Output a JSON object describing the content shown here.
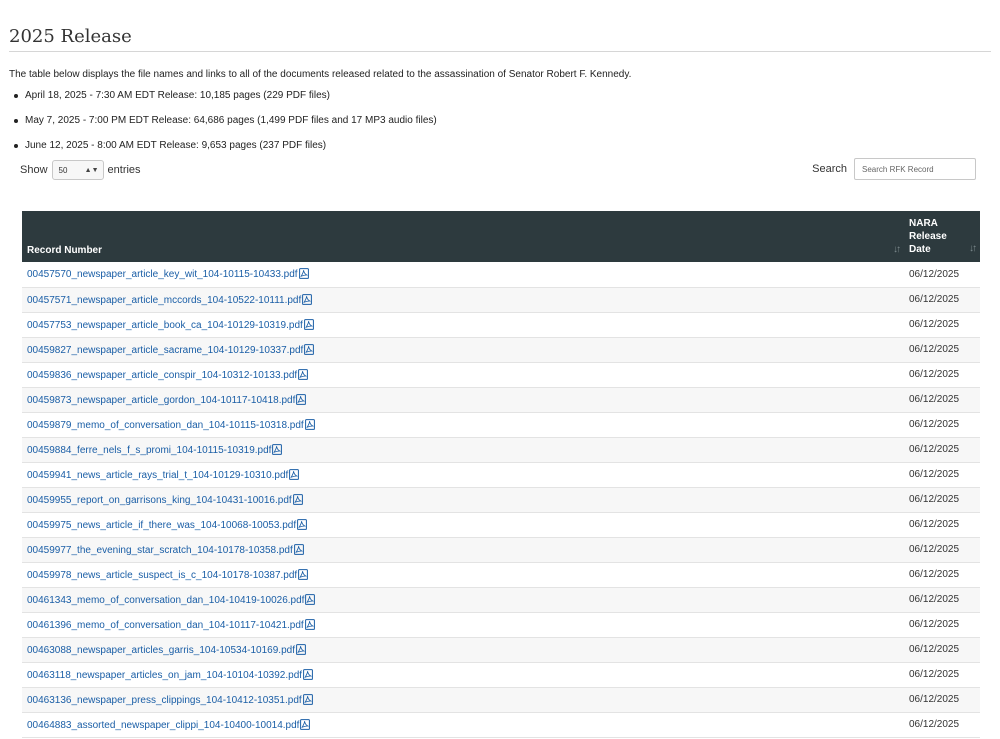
{
  "heading": "2025 Release",
  "intro": "The table below displays the file names and links to all of the documents released related to the assassination of Senator Robert F. Kennedy.",
  "releases": [
    "April 18, 2025 - 7:30 AM EDT Release: 10,185 pages (229 PDF files)",
    "May 7, 2025 - 7:00 PM EDT Release: 64,686 pages (1,499 PDF files and 17 MP3 audio files)",
    "June 12, 2025 - 8:00 AM EDT Release: 9,653 pages (237 PDF files)"
  ],
  "controls": {
    "show_label": "Show",
    "entries_value": "50",
    "entries_label": "entries",
    "search_label": "Search",
    "search_placeholder": "Search RFK Record"
  },
  "table": {
    "columns": [
      "Record Number",
      "NARA Release Date"
    ],
    "column2_lines": [
      "NARA",
      "Release",
      "Date"
    ],
    "icons": {
      "sort": "sort-icon",
      "file": "pdf-file-icon"
    },
    "rows": [
      {
        "file": "00457570_newspaper_article_key_wit_104-10115-10433.pdf",
        "date": "06/12/2025"
      },
      {
        "file": "00457571_newspaper_article_mccords_104-10522-10111.pdf",
        "date": "06/12/2025"
      },
      {
        "file": "00457753_newspaper_article_book_ca_104-10129-10319.pdf",
        "date": "06/12/2025"
      },
      {
        "file": "00459827_newspaper_article_sacrame_104-10129-10337.pdf",
        "date": "06/12/2025"
      },
      {
        "file": "00459836_newspaper_article_conspir_104-10312-10133.pdf",
        "date": "06/12/2025"
      },
      {
        "file": "00459873_newspaper_article_gordon_104-10117-10418.pdf",
        "date": "06/12/2025"
      },
      {
        "file": "00459879_memo_of_conversation_dan_104-10115-10318.pdf",
        "date": "06/12/2025"
      },
      {
        "file": "00459884_ferre_nels_f_s_promi_104-10115-10319.pdf",
        "date": "06/12/2025"
      },
      {
        "file": "00459941_news_article_rays_trial_t_104-10129-10310.pdf",
        "date": "06/12/2025"
      },
      {
        "file": "00459955_report_on_garrisons_king_104-10431-10016.pdf",
        "date": "06/12/2025"
      },
      {
        "file": "00459975_news_article_if_there_was_104-10068-10053.pdf",
        "date": "06/12/2025"
      },
      {
        "file": "00459977_the_evening_star_scratch_104-10178-10358.pdf",
        "date": "06/12/2025"
      },
      {
        "file": "00459978_news_article_suspect_is_c_104-10178-10387.pdf",
        "date": "06/12/2025"
      },
      {
        "file": "00461343_memo_of_conversation_dan_104-10419-10026.pdf",
        "date": "06/12/2025"
      },
      {
        "file": "00461396_memo_of_conversation_dan_104-10117-10421.pdf",
        "date": "06/12/2025"
      },
      {
        "file": "00463088_newspaper_articles_garris_104-10534-10169.pdf",
        "date": "06/12/2025"
      },
      {
        "file": "00463118_newspaper_articles_on_jam_104-10104-10392.pdf",
        "date": "06/12/2025"
      },
      {
        "file": "00463136_newspaper_press_clippings_104-10412-10351.pdf",
        "date": "06/12/2025"
      },
      {
        "file": "00464883_assorted_newspaper_clippi_104-10400-10014.pdf",
        "date": "06/12/2025"
      }
    ]
  },
  "colors": {
    "header_bg": "#2d3a3e",
    "link": "#1a5ea6"
  }
}
